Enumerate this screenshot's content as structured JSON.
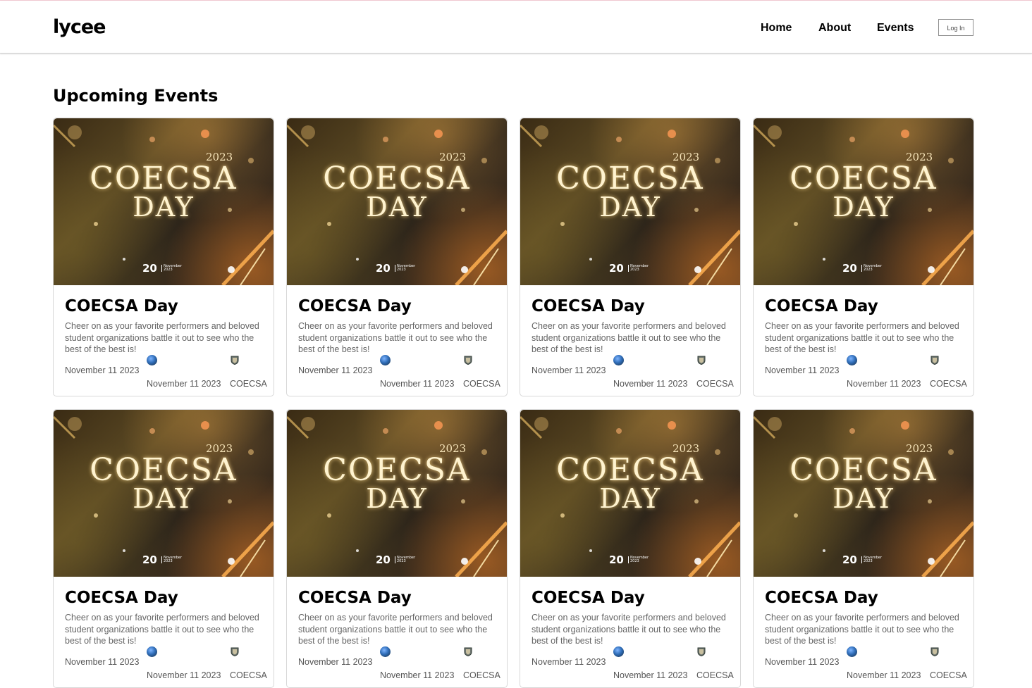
{
  "header": {
    "logo": "lycee",
    "nav": [
      "Home",
      "About",
      "Events"
    ],
    "login_label": "Log In"
  },
  "section_title": "Upcoming Events",
  "poster": {
    "title_line1": "COECSA",
    "title_line2": "DAY",
    "year": "2023",
    "day": "20",
    "month": "November",
    "month_year": "2023"
  },
  "events": [
    {
      "title": "COECSA Day",
      "description": "Cheer on as your favorite performers and beloved student organizations battle it out to see who the best of the best is!",
      "date": "November 11 2023",
      "date2": "November 11 2023",
      "org": "COECSA"
    },
    {
      "title": "COECSA Day",
      "description": "Cheer on as your favorite performers and beloved student organizations battle it out to see who the best of the best is!",
      "date": "November 11 2023",
      "date2": "November 11 2023",
      "org": "COECSA"
    },
    {
      "title": "COECSA Day",
      "description": "Cheer on as your favorite performers and beloved student organizations battle it out to see who the best of the best is!",
      "date": "November 11 2023",
      "date2": "November 11 2023",
      "org": "COECSA"
    },
    {
      "title": "COECSA Day",
      "description": "Cheer on as your favorite performers and beloved student organizations battle it out to see who the best of the best is!",
      "date": "November 11 2023",
      "date2": "November 11 2023",
      "org": "COECSA"
    },
    {
      "title": "COECSA Day",
      "description": "Cheer on as your favorite performers and beloved student organizations battle it out to see who the best of the best is!",
      "date": "November 11 2023",
      "date2": "November 11 2023",
      "org": "COECSA"
    },
    {
      "title": "COECSA Day",
      "description": "Cheer on as your favorite performers and beloved student organizations battle it out to see who the best of the best is!",
      "date": "November 11 2023",
      "date2": "November 11 2023",
      "org": "COECSA"
    },
    {
      "title": "COECSA Day",
      "description": "Cheer on as your favorite performers and beloved student organizations battle it out to see who the best of the best is!",
      "date": "November 11 2023",
      "date2": "November 11 2023",
      "org": "COECSA"
    },
    {
      "title": "COECSA Day",
      "description": "Cheer on as your favorite performers and beloved student organizations battle it out to see who the best of the best is!",
      "date": "November 11 2023",
      "date2": "November 11 2023",
      "org": "COECSA"
    }
  ]
}
